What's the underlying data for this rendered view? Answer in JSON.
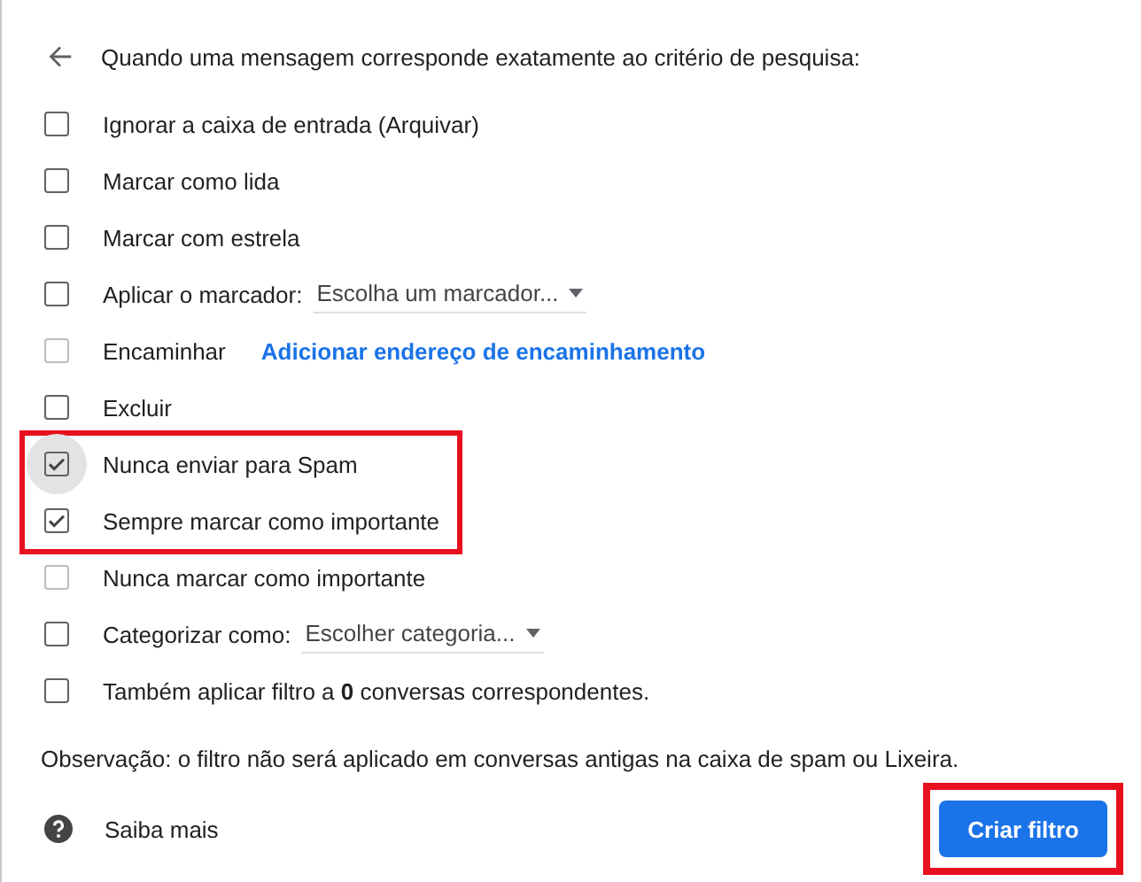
{
  "header": {
    "text": "Quando uma mensagem corresponde exatamente ao critério de pesquisa:"
  },
  "options": [
    {
      "kind": "checkbox",
      "label": "Ignorar a caixa de entrada (Arquivar)",
      "checked": false,
      "disabled": false,
      "focused": false,
      "highlighted": false
    },
    {
      "kind": "checkbox",
      "label": "Marcar como lida",
      "checked": false,
      "disabled": false,
      "focused": false,
      "highlighted": false
    },
    {
      "kind": "checkbox",
      "label": "Marcar com estrela",
      "checked": false,
      "disabled": false,
      "focused": false,
      "highlighted": false
    },
    {
      "kind": "select",
      "label": "Aplicar o marcador:",
      "select": "Escolha um marcador...",
      "checked": false,
      "disabled": false,
      "focused": false,
      "highlighted": false
    },
    {
      "kind": "link",
      "label": "Encaminhar",
      "link": "Adicionar endereço de encaminhamento",
      "checked": false,
      "disabled": true,
      "focused": false,
      "highlighted": false
    },
    {
      "kind": "checkbox",
      "label": "Excluir",
      "checked": false,
      "disabled": false,
      "focused": false,
      "highlighted": false
    },
    {
      "kind": "checkbox",
      "label": "Nunca enviar para Spam",
      "checked": true,
      "disabled": false,
      "focused": true,
      "highlighted": true
    },
    {
      "kind": "checkbox",
      "label": "Sempre marcar como importante",
      "checked": true,
      "disabled": false,
      "focused": false,
      "highlighted": true
    },
    {
      "kind": "checkbox",
      "label": "Nunca marcar como importante",
      "checked": false,
      "disabled": true,
      "focused": false,
      "highlighted": false
    },
    {
      "kind": "select",
      "label": "Categorizar como:",
      "select": "Escolher categoria...",
      "checked": false,
      "disabled": false,
      "focused": false,
      "highlighted": false
    },
    {
      "kind": "checkbox",
      "label": "Também aplicar filtro a **0** conversas correspondentes.",
      "checked": false,
      "disabled": false,
      "focused": false,
      "highlighted": false
    }
  ],
  "note": "Observação: o filtro não será aplicado em conversas antigas na caixa de spam ou Lixeira.",
  "learn_more": "Saiba mais",
  "create_button": {
    "label": "Criar filtro",
    "highlighted": true
  }
}
